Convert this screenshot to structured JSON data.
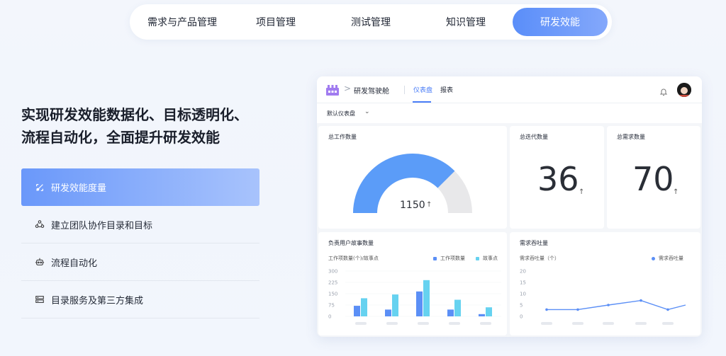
{
  "top_tabs": [
    {
      "label": "需求与产品管理",
      "active": false
    },
    {
      "label": "项目管理",
      "active": false
    },
    {
      "label": "测试管理",
      "active": false
    },
    {
      "label": "知识管理",
      "active": false
    },
    {
      "label": "研发效能",
      "active": true
    }
  ],
  "headline": {
    "line1": "实现研发效能数据化、目标透明化、",
    "line2": "流程自动化，全面提升研发效能"
  },
  "features": [
    {
      "label": "研发效能度量",
      "icon": "measure-icon",
      "active": true
    },
    {
      "label": "建立团队协作目录和目标",
      "icon": "team-icon",
      "active": false
    },
    {
      "label": "流程自动化",
      "icon": "robot-icon",
      "active": false
    },
    {
      "label": "目录服务及第三方集成",
      "icon": "server-icon",
      "active": false
    }
  ],
  "dashboard": {
    "breadcrumb_title": "研发驾驶舱",
    "tabs": [
      {
        "label": "仪表盘",
        "active": true
      },
      {
        "label": "报表",
        "active": false
      }
    ],
    "selector_label": "默认仪表盘",
    "total_work": {
      "title": "总工作数量",
      "value": "1150",
      "fraction": 0.75
    },
    "total_iter": {
      "title": "总迭代数量",
      "value": "36"
    },
    "total_req": {
      "title": "总需求数量",
      "value": "70"
    },
    "story_panel": {
      "title": "负责用户故事数量",
      "axis_label": "工作项数量(个)/故事点",
      "legend": [
        "工作项数量",
        "故事点"
      ],
      "colors": [
        "#5b8ff6",
        "#66d2f0"
      ]
    },
    "throughput_panel": {
      "title": "需求吞吐量",
      "axis_label": "需求吞吐量（个）",
      "legend": [
        "需求吞吐量"
      ],
      "color": "#5b8ff6"
    }
  },
  "chart_data": [
    {
      "type": "bar",
      "title": "负责用户故事数量",
      "ylabel": "工作项数量(个)/故事点",
      "yticks": [
        300,
        225,
        150,
        75,
        0
      ],
      "ylim": [
        0,
        300
      ],
      "categories": [
        "",
        "",
        "",
        "",
        ""
      ],
      "series": [
        {
          "name": "工作项数量",
          "values": [
            70,
            45,
            165,
            45,
            15
          ]
        },
        {
          "name": "故事点",
          "values": [
            120,
            145,
            240,
            110,
            60
          ]
        }
      ],
      "legend": "top-right"
    },
    {
      "type": "line",
      "title": "需求吞吐量",
      "ylabel": "需求吞吐量（个）",
      "yticks": [
        20,
        15,
        10,
        5,
        0
      ],
      "ylim": [
        0,
        20
      ],
      "categories": [
        "",
        "",
        "",
        "",
        "",
        ""
      ],
      "series": [
        {
          "name": "需求吞吐量",
          "values": [
            3,
            3,
            5,
            7,
            3,
            5
          ]
        }
      ],
      "legend": "top-right"
    }
  ]
}
